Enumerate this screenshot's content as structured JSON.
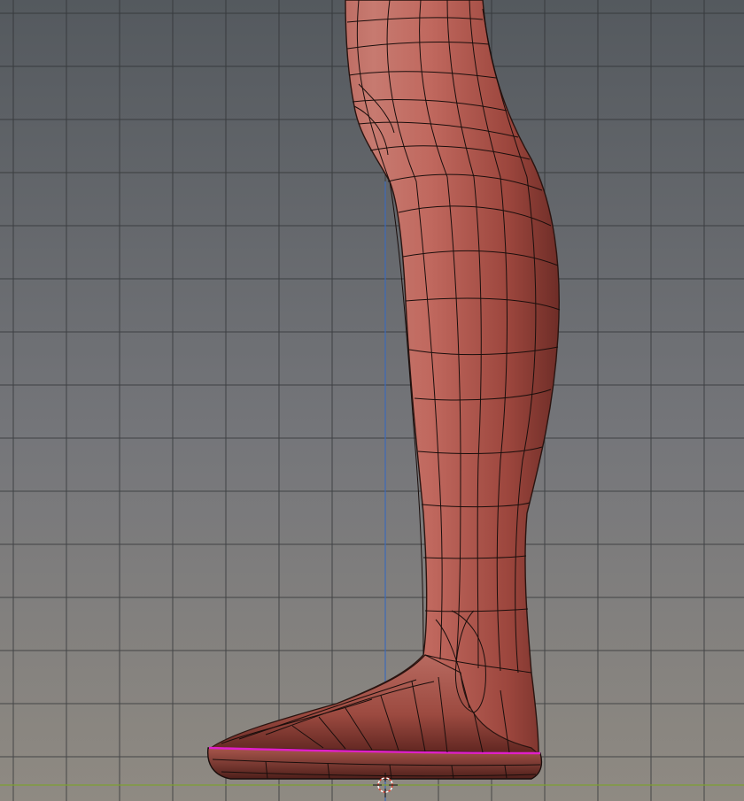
{
  "viewport": {
    "view_type": "3d-viewport",
    "object": "leg-mesh",
    "shading": "solid",
    "mesh_color": "#b5584c",
    "wire_color": "#1a0e0c",
    "selected_edge_color": "#e020c8",
    "background_top_color": "#54595e",
    "background_bottom_color": "#8e8a82",
    "grid_color": "#2e3033",
    "x_axis_color": "#7ea032",
    "z_axis_color": "#3d6ab8",
    "cursor_icon": "3d-cursor-icon"
  }
}
